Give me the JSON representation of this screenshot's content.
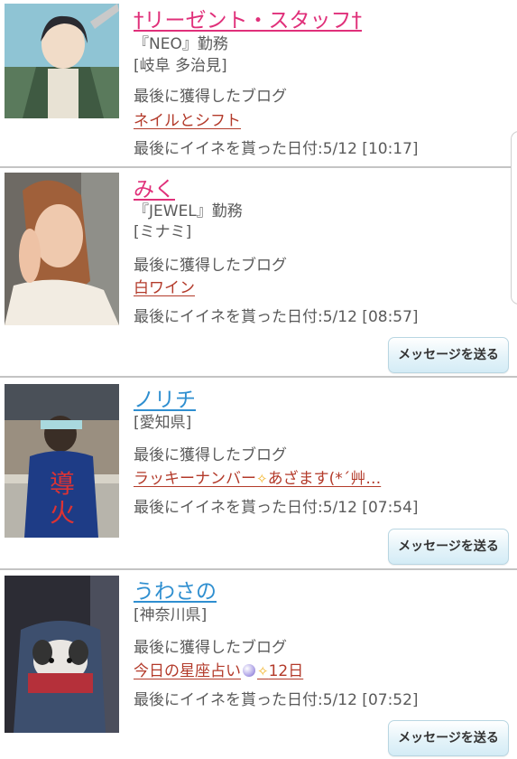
{
  "accent_pink": "#e0307a",
  "accent_blue": "#2f8fd0",
  "link_color": "#b33a2a",
  "entries": [
    {
      "name": "†リーゼント・スタッフ†",
      "shop": "『NEO』勤務",
      "area": "[岐阜 多治見]",
      "blog_heading": "最後に獲得したブログ",
      "blog_title": "ネイルとシフト",
      "like_date": "最後にイイネを貰った日付:5/12 [10:17]",
      "avatar_icon": "anime-soldier-avatar"
    },
    {
      "name": "みく",
      "shop": "『JEWEL』勤務",
      "area": "[ミナミ]",
      "blog_heading": "最後に獲得したブログ",
      "blog_title": "白ワイン",
      "like_date": "最後にイイネを貰った日付:5/12 [08:57]",
      "message_button": "メッセージを送る",
      "avatar_icon": "woman-portrait-avatar"
    },
    {
      "name": "ノリチ",
      "area": "[愛知県]",
      "blog_heading": "最後に獲得したブログ",
      "blog_title_a": "ラッキーナンバー",
      "blog_title_b": "あざます(*´艸…",
      "like_date": "最後にイイネを貰った日付:5/12 [07:54]",
      "message_button": "メッセージを送る",
      "avatar_icon": "man-back-avatar"
    },
    {
      "name": "うわさの",
      "area": "[神奈川県]",
      "blog_heading": "最後に獲得したブログ",
      "blog_title_a": "今日の星座占い",
      "blog_title_b": "12日",
      "like_date": "最後にイイネを貰った日付:5/12 [07:52]",
      "message_button": "メッセージを送る",
      "avatar_icon": "dog-in-bag-avatar"
    }
  ]
}
